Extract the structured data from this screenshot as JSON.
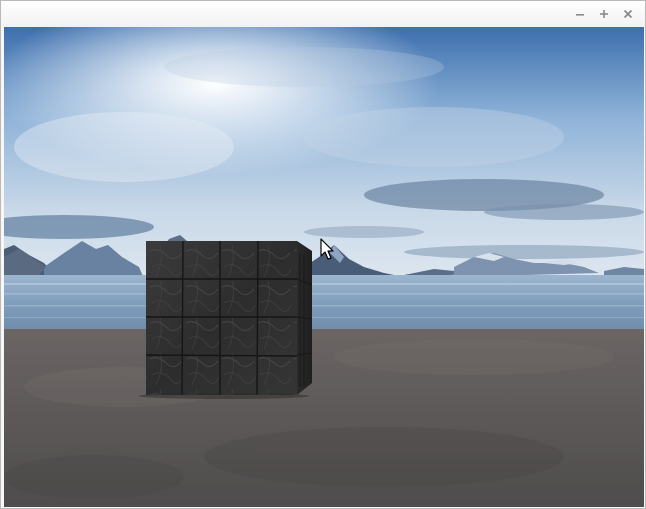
{
  "window": {
    "title": "",
    "controls": {
      "minimize_icon": "minimize-icon",
      "maximize_icon": "maximize-icon",
      "close_icon": "close-icon"
    }
  },
  "scene": {
    "type": "3d-viewport",
    "objects": [
      "skybox",
      "mountains",
      "water",
      "ground-plane",
      "stone-cube"
    ],
    "colors": {
      "sky_top": "#3d6fae",
      "sky_horizon": "#dbe6f2",
      "sun": "#ffffff",
      "water": "#8aa6c4",
      "ground": "#5a5858",
      "cube": "#2f2f2f"
    },
    "cursor_icon": "arrow-cursor-icon"
  }
}
